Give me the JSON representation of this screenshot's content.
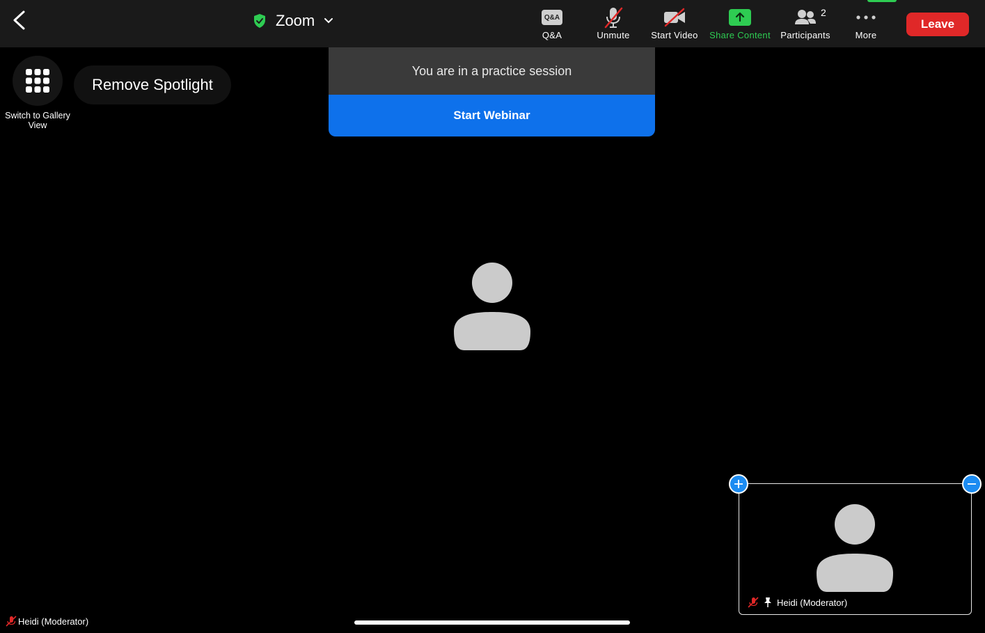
{
  "header": {
    "title": "Zoom",
    "tools": {
      "qa": {
        "label": "Q&A",
        "icon_text": "Q&A"
      },
      "unmute": {
        "label": "Unmute"
      },
      "start_video": {
        "label": "Start Video"
      },
      "share": {
        "label": "Share Content"
      },
      "participants": {
        "label": "Participants",
        "count": "2"
      },
      "more": {
        "label": "More"
      }
    },
    "leave_label": "Leave"
  },
  "view": {
    "gallery_label": "Switch to Gallery View",
    "spotlight_label": "Remove Spotlight"
  },
  "banner": {
    "message": "You are in a practice session",
    "button": "Start Webinar"
  },
  "thumbnail": {
    "name": "Heidi (Moderator)"
  },
  "main": {
    "name": "Heidi (Moderator)"
  },
  "colors": {
    "accent_blue": "#0e71eb",
    "share_green": "#2ecc52",
    "leave_red": "#e02828",
    "muted_red": "#e02828"
  }
}
